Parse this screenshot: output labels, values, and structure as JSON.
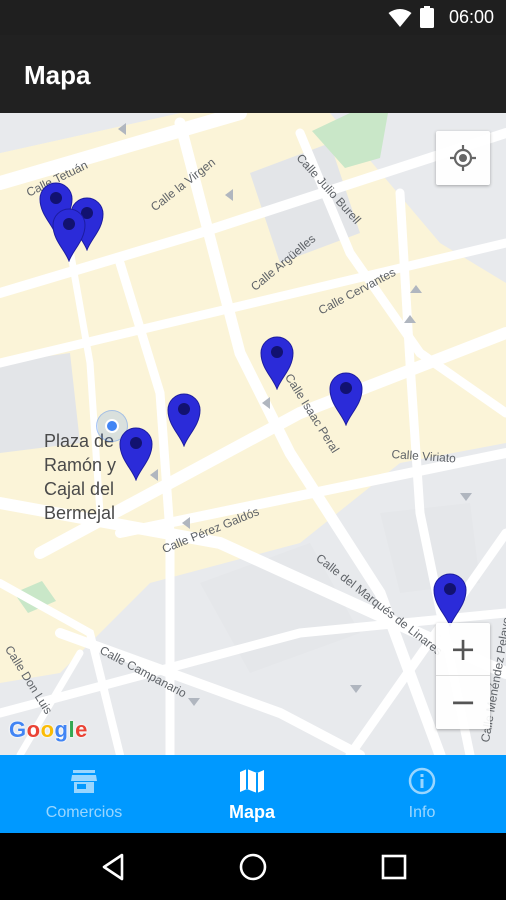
{
  "status_bar": {
    "time": "06:00"
  },
  "app_bar": {
    "title": "Mapa"
  },
  "map": {
    "streets": [
      "Calle Tetuán",
      "Calle la Virgen",
      "Calle Julio Burell",
      "Calle Argüelles",
      "Calle Cervantes",
      "Calle Isaac Peral",
      "Calle Viriato",
      "Calle Pérez Galdós",
      "Calle del Marqués de Linares",
      "Calle Campanario",
      "Calle Don Luis",
      "Calle Menéndez Pelayo"
    ],
    "poi_lines": [
      "Plaza de",
      "Ramón y",
      "Cajal del",
      "Bermejal"
    ],
    "attribution": "Google",
    "marker_color": "#2b2bd9",
    "zoom_in": "+",
    "zoom_out": "−"
  },
  "bottom_nav": {
    "items": [
      {
        "label": "Comercios",
        "icon": "store-icon",
        "active": false
      },
      {
        "label": "Mapa",
        "icon": "map-icon",
        "active": true
      },
      {
        "label": "Info",
        "icon": "info-icon",
        "active": false
      }
    ],
    "background": "#0099ff"
  }
}
